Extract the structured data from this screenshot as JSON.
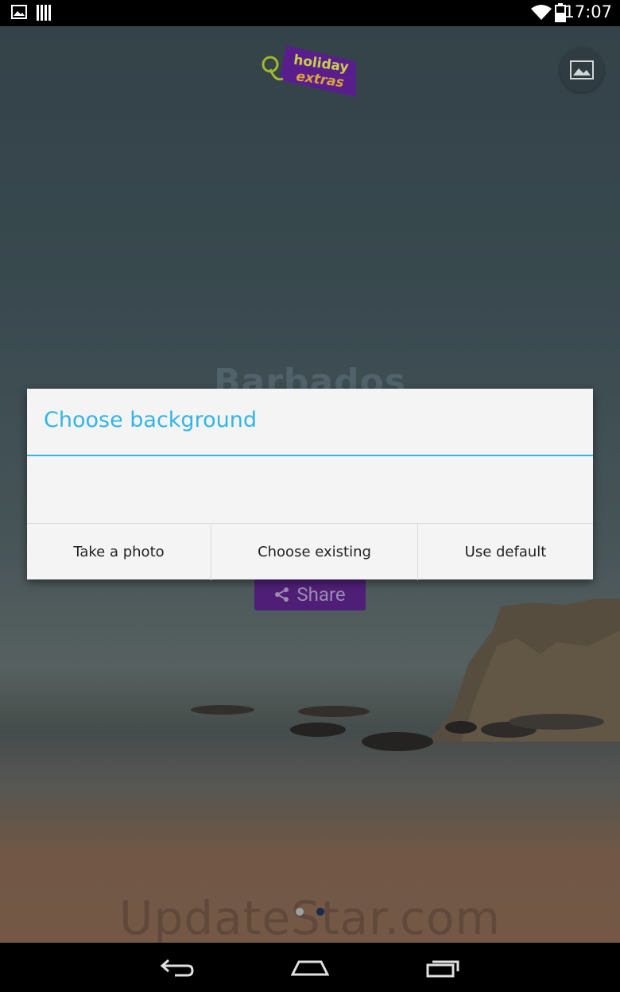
{
  "status_bar": {
    "time": "17:07",
    "icons": [
      "image-icon",
      "barcode-icon",
      "wifi-icon",
      "battery-icon"
    ]
  },
  "app": {
    "logo_text_line1": "holiday",
    "logo_text_line2": "extras",
    "place_title": "Barbados",
    "share_label": "Share",
    "watermark": "UpdateStar.com"
  },
  "dialog": {
    "title": "Choose background",
    "buttons": [
      {
        "label": "Take a photo"
      },
      {
        "label": "Choose existing"
      },
      {
        "label": "Use default"
      }
    ]
  },
  "pager": {
    "total": 2,
    "current": 2
  },
  "nav_bar": {
    "icons": [
      "back-icon",
      "home-icon",
      "recents-icon"
    ]
  },
  "colors": {
    "accent": "#33b5e5",
    "share_bg": "#4f1f77",
    "logo_tag": "#5a1e8c"
  }
}
